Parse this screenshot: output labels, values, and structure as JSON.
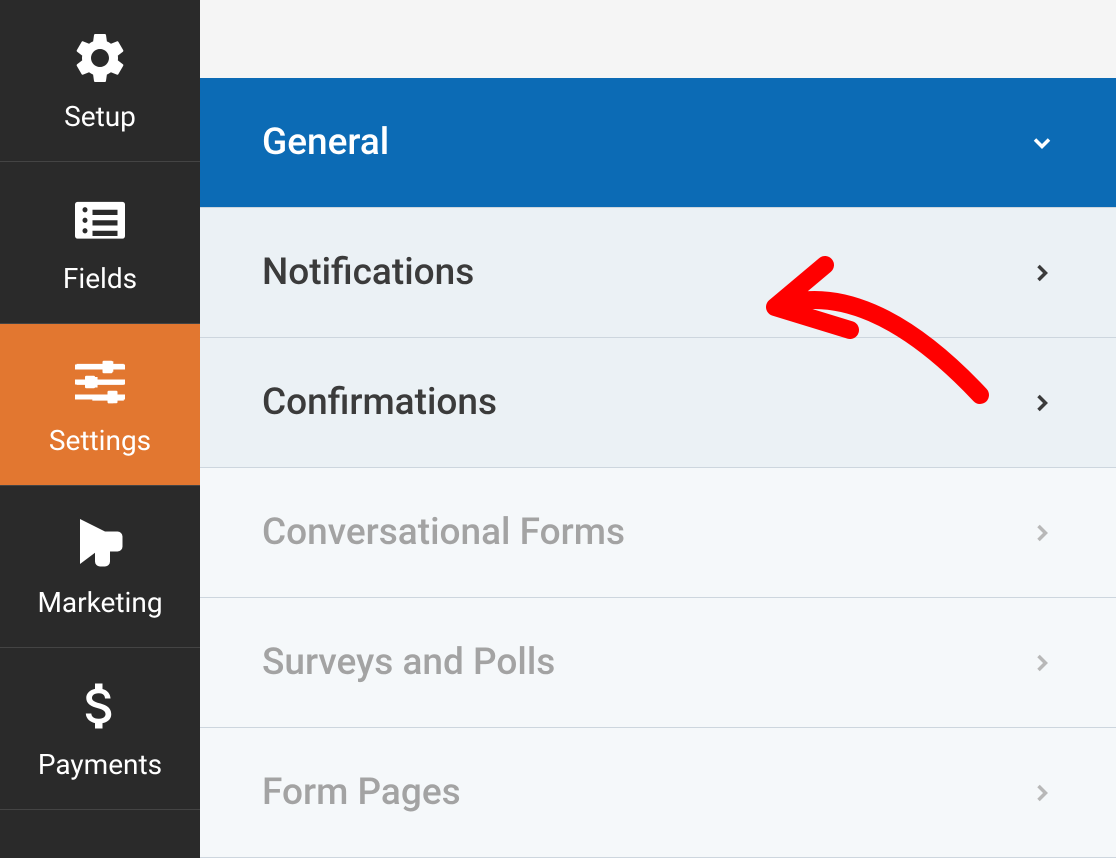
{
  "sidebar": {
    "items": [
      {
        "label": "Setup"
      },
      {
        "label": "Fields"
      },
      {
        "label": "Settings"
      },
      {
        "label": "Marketing"
      },
      {
        "label": "Payments"
      }
    ],
    "activeIndex": 2
  },
  "settingsPanel": {
    "items": [
      {
        "label": "General",
        "state": "expanded"
      },
      {
        "label": "Notifications",
        "state": "normal"
      },
      {
        "label": "Confirmations",
        "state": "normal"
      },
      {
        "label": "Conversational Forms",
        "state": "disabled"
      },
      {
        "label": "Surveys and Polls",
        "state": "disabled"
      },
      {
        "label": "Form Pages",
        "state": "disabled"
      }
    ]
  },
  "annotation": {
    "type": "arrow",
    "color": "#ff0000",
    "pointsTo": "Notifications"
  }
}
